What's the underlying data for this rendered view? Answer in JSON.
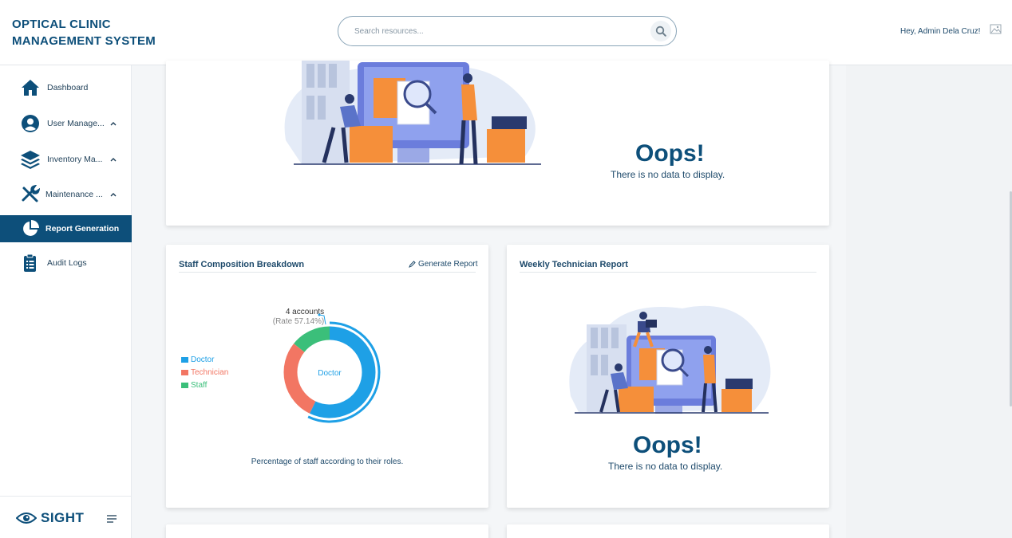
{
  "header": {
    "brand_line1": "OPTICAL CLINIC",
    "brand_line2": "MANAGEMENT SYSTEM",
    "search_placeholder": "Search resources...",
    "greeting": "Hey, Admin Dela Cruz!"
  },
  "sidebar": {
    "items": [
      {
        "label": "Dashboard",
        "icon": "home-icon",
        "expandable": false,
        "active": false
      },
      {
        "label": "User Manage...",
        "icon": "user-icon",
        "expandable": true,
        "active": false
      },
      {
        "label": "Inventory Ma...",
        "icon": "layers-icon",
        "expandable": true,
        "active": false
      },
      {
        "label": "Maintenance ...",
        "icon": "tools-icon",
        "expandable": true,
        "active": false
      },
      {
        "label": "Report Generation",
        "icon": "pie-chart-icon",
        "expandable": false,
        "active": true
      },
      {
        "label": "Audit Logs",
        "icon": "clipboard-icon",
        "expandable": false,
        "active": false
      }
    ],
    "footer_logo": "SIGHT"
  },
  "cards": {
    "top": {
      "oops_title": "Oops!",
      "oops_message": "There is no data to display."
    },
    "staff": {
      "title": "Staff Composition Breakdown",
      "generate_label": "Generate Report",
      "callout_count": "4 accounts",
      "callout_rate": "(Rate 57.14%)",
      "center_label": "Doctor",
      "caption": "Percentage of staff according to their roles."
    },
    "weekly": {
      "title": "Weekly Technician Report",
      "oops_title": "Oops!",
      "oops_message": "There is no data to display."
    }
  },
  "colors": {
    "primary": "#0d4f7a",
    "doctor": "#1ea0e6",
    "technician": "#f27663",
    "staff": "#3bbf7a"
  },
  "chart_data": {
    "type": "pie",
    "title": "Staff Composition Breakdown",
    "categories": [
      "Doctor",
      "Technician",
      "Staff"
    ],
    "values": [
      4,
      2,
      1
    ],
    "legend_position": "left",
    "highlighted": "Doctor"
  }
}
